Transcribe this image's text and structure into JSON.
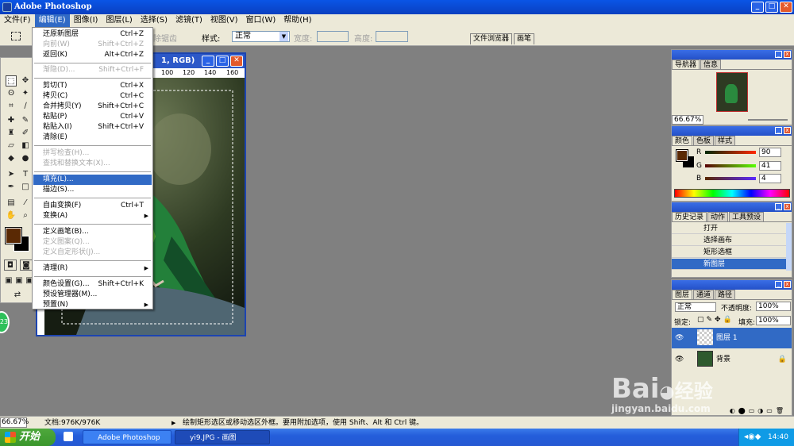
{
  "window": {
    "title": "Adobe Photoshop"
  },
  "menubar": [
    {
      "label": "文件(F)"
    },
    {
      "label": "编辑(E)"
    },
    {
      "label": "图像(I)"
    },
    {
      "label": "图层(L)"
    },
    {
      "label": "选择(S)"
    },
    {
      "label": "滤镜(T)"
    },
    {
      "label": "视图(V)"
    },
    {
      "label": "窗口(W)"
    },
    {
      "label": "帮助(H)"
    }
  ],
  "options": {
    "feather_disabled": "除锯齿",
    "style_label": "样式:",
    "style_value": "正常",
    "width_label": "宽度:",
    "height_label": "高度:",
    "tab_file_browser": "文件浏览器",
    "tab_brushes": "画笔"
  },
  "edit_menu": {
    "items": [
      {
        "label": "还原新图层",
        "shortcut": "Ctrl+Z"
      },
      {
        "label": "向前(W)",
        "shortcut": "Shift+Ctrl+Z"
      },
      {
        "label": "返回(K)",
        "shortcut": "Alt+Ctrl+Z"
      },
      {
        "label": "渐隐(D)...",
        "shortcut": "Shift+Ctrl+F"
      },
      {
        "label": "剪切(T)",
        "shortcut": "Ctrl+X"
      },
      {
        "label": "拷贝(C)",
        "shortcut": "Ctrl+C"
      },
      {
        "label": "合并拷贝(Y)",
        "shortcut": "Shift+Ctrl+C"
      },
      {
        "label": "粘贴(P)",
        "shortcut": "Ctrl+V"
      },
      {
        "label": "粘贴入(I)",
        "shortcut": "Shift+Ctrl+V"
      },
      {
        "label": "清除(E)",
        "shortcut": ""
      },
      {
        "label": "拼写检查(H)...",
        "shortcut": ""
      },
      {
        "label": "查找和替换文本(X)...",
        "shortcut": ""
      },
      {
        "label": "填充(L)...",
        "shortcut": ""
      },
      {
        "label": "描边(S)...",
        "shortcut": ""
      },
      {
        "label": "自由变换(F)",
        "shortcut": "Ctrl+T"
      },
      {
        "label": "变换(A)",
        "shortcut": ""
      },
      {
        "label": "定义画笔(B)...",
        "shortcut": ""
      },
      {
        "label": "定义图案(Q)...",
        "shortcut": ""
      },
      {
        "label": "定义自定形状(J)...",
        "shortcut": ""
      },
      {
        "label": "清理(R)",
        "shortcut": ""
      },
      {
        "label": "颜色设置(G)...",
        "shortcut": "Shift+Ctrl+K"
      },
      {
        "label": "预设管理器(M)...",
        "shortcut": ""
      },
      {
        "label": "预置(N)",
        "shortcut": ""
      }
    ]
  },
  "document": {
    "title_fragment": "1, RGB)",
    "ruler_ticks": [
      "100",
      "120",
      "140",
      "160"
    ]
  },
  "navigator": {
    "tabs": [
      "导航器",
      "信息"
    ],
    "zoom": "66.67%"
  },
  "color_panel": {
    "tabs": [
      "颜色",
      "色板",
      "样式"
    ],
    "r_label": "R",
    "r_value": "90",
    "g_label": "G",
    "g_value": "41",
    "b_label": "B",
    "b_value": "4",
    "foreground": "#5a2904"
  },
  "history": {
    "tabs": [
      "历史记录",
      "动作",
      "工具预设"
    ],
    "items": [
      "打开",
      "选择画布",
      "矩形选框",
      "新图层"
    ]
  },
  "layers": {
    "tabs": [
      "图层",
      "通道",
      "路径"
    ],
    "blend_mode": "正常",
    "opacity_label": "不透明度:",
    "opacity_value": "100%",
    "lock_label": "锁定:",
    "fill_label": "填充:",
    "fill_value": "100%",
    "items": [
      "图层 1",
      "背景"
    ]
  },
  "statusbar": {
    "zoom": "66.67%",
    "doc_size": "文档:976K/976K",
    "hint": "绘制矩形选区或移动选区外框。要用附加选项，使用 Shift、Alt 和 Ctrl 键。"
  },
  "taskbar": {
    "start": "开始",
    "tasks": [
      "Adobe Photoshop",
      "yi9.JPG - 画图"
    ],
    "clock": "14:40"
  },
  "watermark": {
    "brand": "Bai",
    "brand2": "经验",
    "url": "jingyan.baidu.com"
  }
}
